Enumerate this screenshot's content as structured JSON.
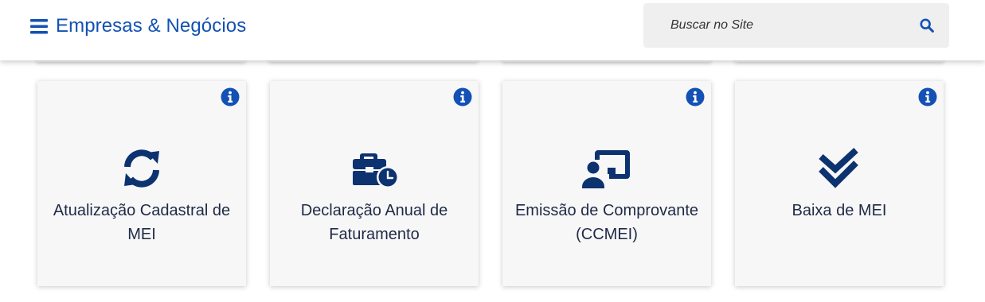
{
  "header": {
    "title": "Empresas & Negócios",
    "menu_icon": "hamburger-icon",
    "search": {
      "placeholder": "Buscar no Site",
      "button_icon": "search-icon"
    }
  },
  "colors": {
    "brand": "#1351b4",
    "icon_dark": "#0c326f",
    "text": "#1f2a44",
    "card_bg": "#f7f7f8",
    "search_bg": "#efefef"
  },
  "cards": [
    {
      "label": "Atualização Cadastral de MEI",
      "icon": "sync-icon",
      "info_icon": "info-icon"
    },
    {
      "label": "Declaração Anual de Faturamento",
      "icon": "briefcase-clock-icon",
      "info_icon": "info-icon"
    },
    {
      "label": "Emissão de Comprovante (CCMEI)",
      "icon": "user-presentation-icon",
      "info_icon": "info-icon"
    },
    {
      "label": "Baixa de MEI",
      "icon": "double-check-icon",
      "info_icon": "info-icon"
    }
  ]
}
